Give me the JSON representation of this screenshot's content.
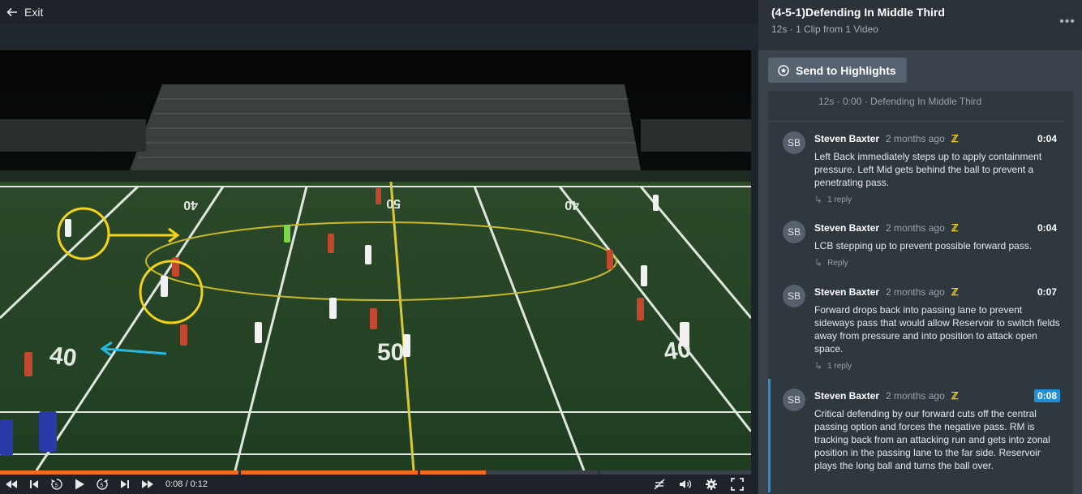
{
  "topbar": {
    "exit_label": "Exit"
  },
  "player": {
    "timecode": "0:08 / 0:12",
    "progress_fraction": 0.647,
    "chapter_marks_fraction": [
      0.317,
      0.556,
      0.796
    ]
  },
  "field_numbers": {
    "n40_left": "40",
    "n50": "50",
    "n40_right": "40",
    "far_40_left": "40",
    "far_50": "50",
    "far_40_right": "40"
  },
  "playlist": {
    "title": "(4-5-1)Defending In Middle Third",
    "meta": "12s · 1 Clip from 1 Video",
    "more_label": "•••"
  },
  "send_button": {
    "label": "Send to Highlights"
  },
  "clip": {
    "line": "12s · 0:00 · Defending In Middle Third"
  },
  "comments": [
    {
      "initials": "SB",
      "author": "Steven Baxter",
      "time_ago": "2 months ago",
      "timestamp": "0:04",
      "body": "Left Back immediately steps up to apply containment pressure. Left Mid gets behind the ball to prevent a penetrating pass.",
      "reply": "1 reply"
    },
    {
      "initials": "SB",
      "author": "Steven Baxter",
      "time_ago": "2 months ago",
      "timestamp": "0:04",
      "body": "LCB stepping up to prevent possible forward pass.",
      "reply": "Reply"
    },
    {
      "initials": "SB",
      "author": "Steven Baxter",
      "time_ago": "2 months ago",
      "timestamp": "0:07",
      "body": "Forward drops back into passing lane to prevent sideways pass that would allow Reservoir to switch fields away from pressure and into position to attack open space.",
      "reply": "1 reply"
    },
    {
      "initials": "SB",
      "author": "Steven Baxter",
      "time_ago": "2 months ago",
      "timestamp": "0:08",
      "body": "Critical defending by our forward cuts off the central passing option and forces the negative pass. RM is tracking back from an attacking run and gets into zonal position in the passing lane to the far side. Reservoir plays the long ball and turns the ball over.",
      "reply": ""
    }
  ],
  "colors": {
    "accent_orange": "#ee6b1f",
    "accent_blue": "#1f8fd6",
    "annotation_yellow": "#f4d21a",
    "annotation_cyan": "#27b8e0"
  }
}
